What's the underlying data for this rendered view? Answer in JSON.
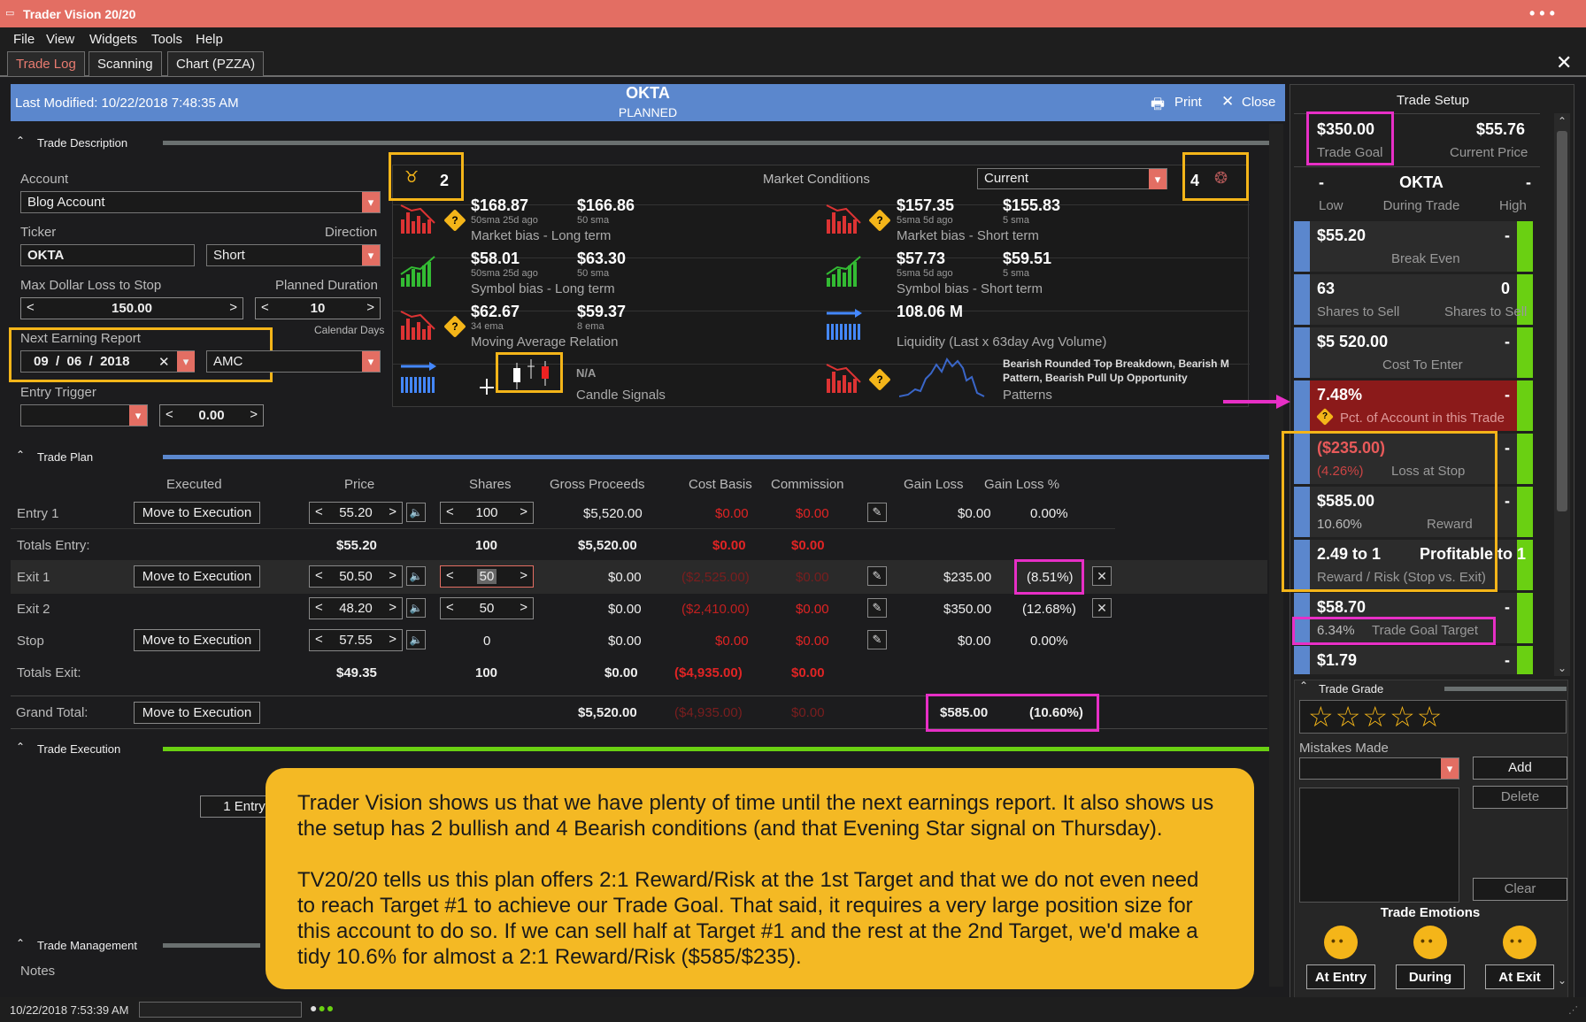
{
  "window": {
    "title": "Trader Vision 20/20"
  },
  "menu": [
    "File",
    "View",
    "Widgets",
    "Tools",
    "Help"
  ],
  "tabs": [
    "Trade Log",
    "Scanning",
    "Chart (PZZA)"
  ],
  "header": {
    "last_modified": "Last Modified: 10/22/2018 7:48:35 AM",
    "ticker": "OKTA",
    "status": "PLANNED",
    "print": "Print",
    "close": "Close"
  },
  "trade_description": {
    "section_title": "Trade Description",
    "account_label": "Account",
    "account_value": "Blog Account",
    "ticker_label": "Ticker",
    "ticker_value": "OKTA",
    "direction_label": "Direction",
    "direction_value": "Short",
    "max_loss_label": "Max Dollar Loss to Stop",
    "max_loss_value": "150.00",
    "duration_label": "Planned Duration",
    "duration_value": "10",
    "duration_unit": "Calendar Days",
    "earnings_label": "Next Earning Report",
    "earnings_month": "09",
    "earnings_day": "06",
    "earnings_year": "2018",
    "earnings_time": "AMC",
    "entry_trigger_label": "Entry Trigger",
    "entry_trigger_value": "0.00"
  },
  "market_conditions": {
    "title": "Market Conditions",
    "selector": "Current",
    "bullish_count": "2",
    "bearish_count": "4",
    "cells": [
      {
        "v1": "$168.87",
        "s1": "50sma 25d ago",
        "v2": "$166.86",
        "s2": "50 sma",
        "label": "Market bias - Long term"
      },
      {
        "v1": "$157.35",
        "s1": "5sma 5d ago",
        "v2": "$155.83",
        "s2": "5 sma",
        "label": "Market bias - Short term"
      },
      {
        "v1": "$58.01",
        "s1": "50sma 25d ago",
        "v2": "$63.30",
        "s2": "50 sma",
        "label": "Symbol bias - Long term"
      },
      {
        "v1": "$57.73",
        "s1": "5sma 5d ago",
        "v2": "$59.51",
        "s2": "5 sma",
        "label": "Symbol bias - Short term"
      },
      {
        "v1": "$62.67",
        "s1": "34 ema",
        "v2": "$59.37",
        "s2": "8 ema",
        "label": "Moving Average Relation"
      },
      {
        "v1": "108.06 M",
        "label": "Liquidity (Last x 63day Avg Volume)"
      },
      {
        "v1": "N/A",
        "label": "Candle Signals"
      },
      {
        "v1": "Bearish Rounded Top Breakdown, Bearish M Pattern, Bearish Pull Up Opportunity",
        "label": "Patterns"
      }
    ]
  },
  "trade_plan": {
    "section_title": "Trade Plan",
    "columns": [
      "Executed",
      "Price",
      "Shares",
      "Gross Proceeds",
      "Cost Basis",
      "Commission",
      "Gain Loss",
      "Gain Loss %"
    ],
    "move_btn": "Move to Execution",
    "entry1": {
      "label": "Entry 1",
      "price": "55.20",
      "shares": "100",
      "gross": "$5,520.00",
      "cost": "$0.00",
      "comm": "$0.00",
      "gl": "$0.00",
      "glp": "0.00%"
    },
    "totals_entry": {
      "label": "Totals Entry:",
      "price": "$55.20",
      "shares": "100",
      "gross": "$5,520.00",
      "cost": "$0.00",
      "comm": "$0.00"
    },
    "exit1": {
      "label": "Exit 1",
      "price": "50.50",
      "shares": "50",
      "gross": "$0.00",
      "cost": "($2,525.00)",
      "comm": "$0.00",
      "gl": "$235.00",
      "glp": "(8.51%)"
    },
    "exit2": {
      "label": "Exit 2",
      "price": "48.20",
      "shares": "50",
      "gross": "$0.00",
      "cost": "($2,410.00)",
      "comm": "$0.00",
      "gl": "$350.00",
      "glp": "(12.68%)"
    },
    "stop": {
      "label": "Stop",
      "price": "57.55",
      "shares": "0",
      "gross": "$0.00",
      "cost": "$0.00",
      "comm": "$0.00",
      "gl": "$0.00",
      "glp": "0.00%"
    },
    "totals_exit": {
      "label": "Totals Exit:",
      "price": "$49.35",
      "shares": "100",
      "gross": "$0.00",
      "cost": "($4,935.00)",
      "comm": "$0.00"
    },
    "grand": {
      "label": "Grand Total:",
      "gross": "$5,520.00",
      "cost": "($4,935.00)",
      "comm": "$0.00",
      "gl": "$585.00",
      "glp": "(10.60%)"
    }
  },
  "trade_execution": {
    "section_title": "Trade Execution",
    "entry_btn": "1 Entry"
  },
  "trade_management": {
    "section_title": "Trade Management",
    "notes_label": "Notes"
  },
  "trade_setup": {
    "title": "Trade Setup",
    "goal": "$350.00",
    "goal_label": "Trade Goal",
    "price": "$55.76",
    "price_label": "Current Price",
    "low": "-",
    "low_label": "Low",
    "ticker": "OKTA",
    "during": "During Trade",
    "high": "-",
    "high_label": "High",
    "breakeven": "$55.20",
    "breakeven_label": "Break Even",
    "breakeven_r": "-",
    "shares": "63",
    "shares_label": "Shares to Sell",
    "shares2": "0",
    "shares2_label": "Shares to Sell",
    "cost": "$5 520.00",
    "cost_label": "Cost To Enter",
    "cost_r": "-",
    "pct": "7.48%",
    "pct_label": "Pct. of Account in this Trade",
    "pct_r": "-",
    "loss": "($235.00)",
    "loss_pct": "(4.26%)",
    "loss_label": "Loss at Stop",
    "loss_r": "-",
    "reward": "$585.00",
    "reward_pct": "10.60%",
    "reward_label": "Reward",
    "reward_r": "-",
    "rr": "2.49 to 1",
    "rr2": "Profitable to 1",
    "rr_label": "Reward / Risk (Stop vs. Exit)",
    "target": "$58.70",
    "target_pct": "6.34%",
    "target_label": "Trade Goal Target",
    "target_r": "-",
    "last": "$1.79",
    "last_r": "-"
  },
  "grade": {
    "title": "Trade Grade",
    "stars": "☆☆☆☆☆",
    "mistakes_label": "Mistakes Made",
    "add": "Add",
    "delete": "Delete",
    "clear": "Clear",
    "emotions_title": "Trade Emotions",
    "at_entry": "At Entry",
    "during": "During",
    "at_exit": "At Exit"
  },
  "annotation": {
    "p1": "Trader Vision shows us that we have plenty of time until the next earnings report.  It also shows us the setup has 2 bullish and 4 Bearish conditions (and that Evening Star signal on Thursday).",
    "p2": "TV20/20 tells us this plan offers 2:1 Reward/Risk at the 1st Target and that we do not even need to reach Target #1 to achieve our Trade Goal.  That said, it requires a very large position size for this account to do so.  If we can sell half at Target #1 and the rest at the 2nd Target, we'd make a tidy 10.6% for almost a 2:1 Reward/Risk ($585/$235)."
  },
  "status": {
    "time": "10/22/2018 7:53:39 AM"
  },
  "colors": {
    "titlebar": "#e36e63",
    "header": "#5b87cd",
    "highlight_yellow": "#f4b519",
    "highlight_magenta": "#e72fc6",
    "green": "#6ad012",
    "loss_red": "#8b1a1a"
  }
}
